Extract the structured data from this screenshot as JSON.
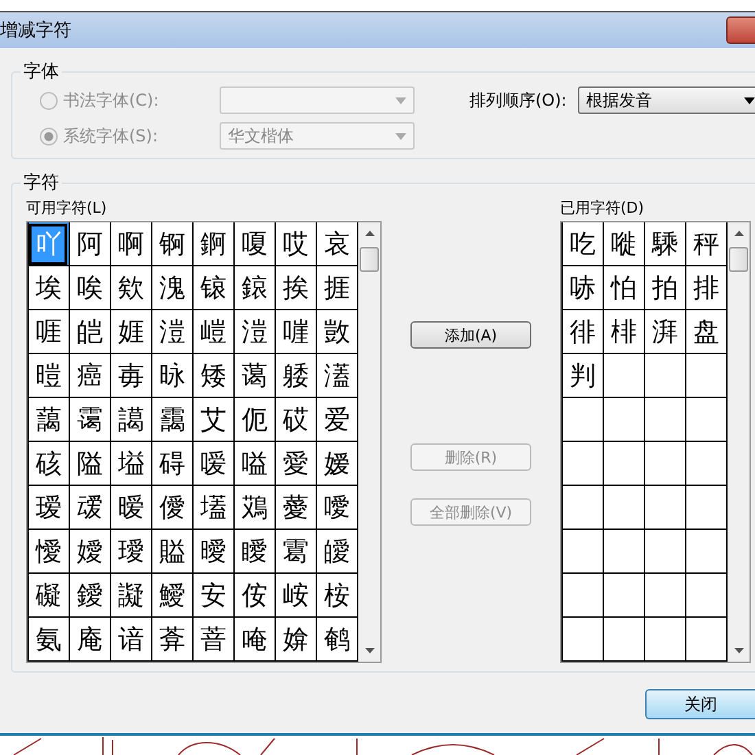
{
  "window": {
    "title": "增减字符"
  },
  "font_group": {
    "title": "字体",
    "options": [
      {
        "label": "书法字体(C):",
        "selected": false,
        "disabled": true
      },
      {
        "label": "系统字体(S):",
        "selected": true,
        "disabled": true,
        "value": "华文楷体"
      }
    ],
    "sort": {
      "label": "排列顺序(O):",
      "value": "根据发音"
    }
  },
  "chars_group": {
    "title": "字符",
    "available": {
      "label": "可用字符(L)",
      "cells": [
        {
          "text": "吖",
          "selected": true
        },
        {
          "text": "阿",
          "selected": false
        },
        {
          "text": "啊",
          "selected": false
        },
        {
          "text": "锕",
          "selected": false
        },
        {
          "text": "錒",
          "selected": false
        },
        {
          "text": "嗄",
          "selected": false
        },
        {
          "text": "哎",
          "selected": false
        },
        {
          "text": "哀",
          "selected": false
        },
        {
          "text": "埃",
          "selected": false
        },
        {
          "text": "唉",
          "selected": false
        },
        {
          "text": "欸",
          "selected": false
        },
        {
          "text": "溾",
          "selected": false
        },
        {
          "text": "锿",
          "selected": false
        },
        {
          "text": "鎄",
          "selected": false
        },
        {
          "text": "挨",
          "selected": false
        },
        {
          "text": "捱",
          "selected": false
        },
        {
          "text": "啀",
          "selected": false
        },
        {
          "text": "皑",
          "selected": false
        },
        {
          "text": "娾",
          "selected": false
        },
        {
          "text": "溰",
          "selected": false
        },
        {
          "text": "嵦",
          "selected": false
        },
        {
          "text": "溰",
          "selected": false
        },
        {
          "text": "嘊",
          "selected": false
        },
        {
          "text": "敳",
          "selected": false
        },
        {
          "text": "暟",
          "selected": false
        },
        {
          "text": "癌",
          "selected": false
        },
        {
          "text": "毐",
          "selected": false
        },
        {
          "text": "昹",
          "selected": false
        },
        {
          "text": "矮",
          "selected": false
        },
        {
          "text": "蔼",
          "selected": false
        },
        {
          "text": "躷",
          "selected": false
        },
        {
          "text": "濭",
          "selected": false
        },
        {
          "text": "藹",
          "selected": false
        },
        {
          "text": "霭",
          "selected": false
        },
        {
          "text": "譪",
          "selected": false
        },
        {
          "text": "靄",
          "selected": false
        },
        {
          "text": "艾",
          "selected": false
        },
        {
          "text": "伌",
          "selected": false
        },
        {
          "text": "砹",
          "selected": false
        },
        {
          "text": "爱",
          "selected": false
        },
        {
          "text": "硋",
          "selected": false
        },
        {
          "text": "隘",
          "selected": false
        },
        {
          "text": "塧",
          "selected": false
        },
        {
          "text": "碍",
          "selected": false
        },
        {
          "text": "嗳",
          "selected": false
        },
        {
          "text": "嗌",
          "selected": false
        },
        {
          "text": "愛",
          "selected": false
        },
        {
          "text": "嫒",
          "selected": false
        },
        {
          "text": "瑷",
          "selected": false
        },
        {
          "text": "叆",
          "selected": false
        },
        {
          "text": "暧",
          "selected": false
        },
        {
          "text": "僾",
          "selected": false
        },
        {
          "text": "壒",
          "selected": false
        },
        {
          "text": "鴱",
          "selected": false
        },
        {
          "text": "薆",
          "selected": false
        },
        {
          "text": "噯",
          "selected": false
        },
        {
          "text": "懓",
          "selected": false
        },
        {
          "text": "嬡",
          "selected": false
        },
        {
          "text": "璦",
          "selected": false
        },
        {
          "text": "賹",
          "selected": false
        },
        {
          "text": "曖",
          "selected": false
        },
        {
          "text": "瞹",
          "selected": false
        },
        {
          "text": "䨠",
          "selected": false
        },
        {
          "text": "皧",
          "selected": false
        },
        {
          "text": "礙",
          "selected": false
        },
        {
          "text": "鑀",
          "selected": false
        },
        {
          "text": "譺",
          "selected": false
        },
        {
          "text": "鱫",
          "selected": false
        },
        {
          "text": "安",
          "selected": false
        },
        {
          "text": "侒",
          "selected": false
        },
        {
          "text": "峖",
          "selected": false
        },
        {
          "text": "桉",
          "selected": false
        },
        {
          "text": "氨",
          "selected": false
        },
        {
          "text": "庵",
          "selected": false
        },
        {
          "text": "谙",
          "selected": false
        },
        {
          "text": "葊",
          "selected": false
        },
        {
          "text": "萻",
          "selected": false
        },
        {
          "text": "唵",
          "selected": false
        },
        {
          "text": "媕",
          "selected": false
        },
        {
          "text": "鹌",
          "selected": false
        }
      ]
    },
    "used": {
      "label": "已用字符(D)",
      "cells": [
        "吃",
        "嘥",
        "騬",
        "秤",
        "哧",
        "怕",
        "拍",
        "排",
        "徘",
        "棑",
        "湃",
        "盘",
        "判"
      ]
    },
    "buttons": [
      {
        "label": "添加(A)",
        "disabled": false
      },
      {
        "label": "删除(R)",
        "disabled": true
      },
      {
        "label": "全部删除(V)",
        "disabled": true
      }
    ]
  },
  "close_button": {
    "label": "关闭",
    "default": true
  }
}
